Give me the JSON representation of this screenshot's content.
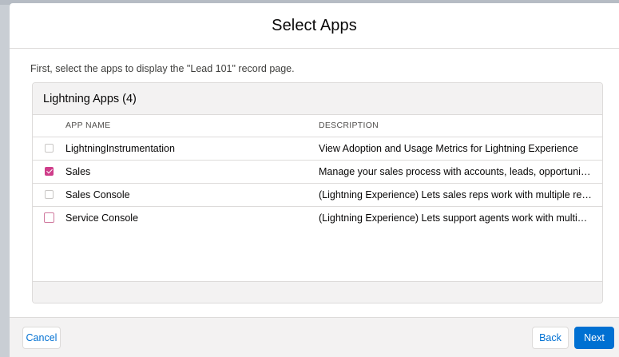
{
  "modal": {
    "title": "Select Apps",
    "intro": "First, select the apps to display the \"Lead 101\" record page."
  },
  "card": {
    "title": "Lightning Apps (4)",
    "columns": {
      "name": "APP NAME",
      "description": "DESCRIPTION"
    },
    "rows": [
      {
        "name": "LightningInstrumentation",
        "description": "View Adoption and Usage Metrics for Lightning Experience",
        "checked": false
      },
      {
        "name": "Sales",
        "description": "Manage your sales process with accounts, leads, opportunities, and ...",
        "checked": true
      },
      {
        "name": "Sales Console",
        "description": "(Lightning Experience) Lets sales reps work with multiple records on...",
        "checked": false
      },
      {
        "name": "Service Console",
        "description": "(Lightning Experience) Lets support agents work with multiple recor...",
        "checked": false
      }
    ]
  },
  "footer": {
    "cancel_label": "Cancel",
    "back_label": "Back",
    "next_label": "Next"
  },
  "colors": {
    "brand": "#0070d2",
    "checkbox_checked": "#cf3d8a"
  }
}
